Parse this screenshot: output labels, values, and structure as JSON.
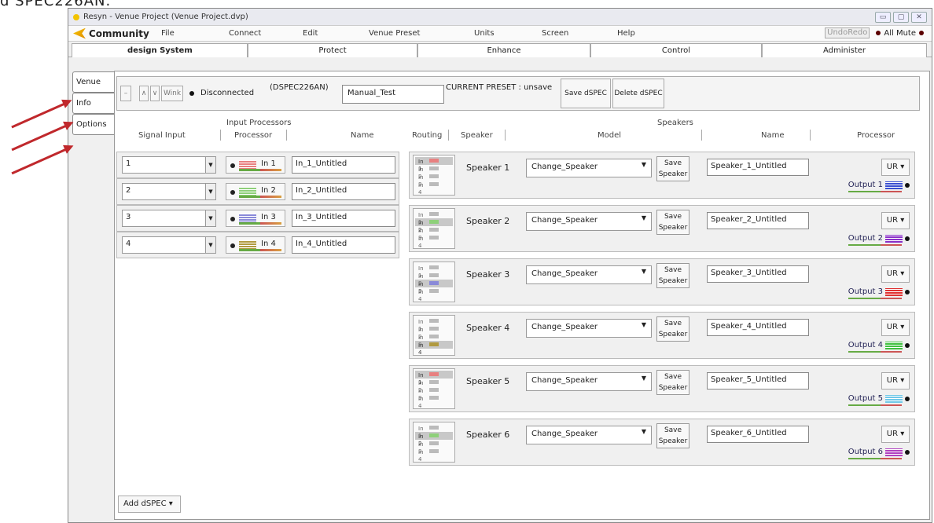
{
  "cut_text": "d SPEC226AN.",
  "window": {
    "title": "Resyn - Venue Project (Venue Project.dvp)",
    "controls": [
      "▭",
      "▢",
      "✕"
    ]
  },
  "menu": {
    "brand": "Community",
    "items": [
      "File",
      "Connect",
      "Edit",
      "Venue Preset",
      "Units",
      "Screen",
      "Help"
    ],
    "undo": "Undo",
    "redo": "Redo",
    "all_mute": "All Mute"
  },
  "tabs": [
    "design System",
    "Protect",
    "Enhance",
    "Control",
    "Administer"
  ],
  "side_tabs": [
    "Venue",
    "Info",
    "Options"
  ],
  "toolbar": {
    "collapse": "–",
    "up": "∧",
    "down": "∨",
    "wink": "Wink",
    "status": "Disconnected",
    "device": "(DSPEC226AN)",
    "device_name": "Manual_Test",
    "preset": "CURRENT PRESET : unsave",
    "save": "Save dSPEC",
    "delete": "Delete dSPEC"
  },
  "input_header": {
    "group": "Input Processors",
    "signal": "Signal Input",
    "processor": "Processor",
    "name": "Name"
  },
  "speaker_header": {
    "group": "Speakers",
    "routing": "Routing",
    "speaker": "Speaker",
    "model": "Model",
    "name": "Name",
    "processor": "Processor"
  },
  "inputs": [
    {
      "signal": "1",
      "proc": "In 1",
      "name": "In_1_Untitled",
      "color": "#e88080"
    },
    {
      "signal": "2",
      "proc": "In 2",
      "name": "In_2_Untitled",
      "color": "#8ed07a"
    },
    {
      "signal": "3",
      "proc": "In 3",
      "name": "In_3_Untitled",
      "color": "#8a8ad8"
    },
    {
      "signal": "4",
      "proc": "In 4",
      "name": "In_4_Untitled",
      "color": "#b09a40"
    }
  ],
  "routing_labels": [
    "In 1",
    "In 2",
    "In 3",
    "In 4"
  ],
  "speakers": [
    {
      "label": "Speaker 1",
      "model": "Change_Speaker",
      "save": "Save Speaker",
      "name": "Speaker_1_Untitled",
      "ur": "UR ▾",
      "output": "Output 1",
      "color": "#3a4fd0",
      "active": 0
    },
    {
      "label": "Speaker 2",
      "model": "Change_Speaker",
      "save": "Save Speaker",
      "name": "Speaker_2_Untitled",
      "ur": "UR ▾",
      "output": "Output 2",
      "color": "#8a30c8",
      "active": 1
    },
    {
      "label": "Speaker 3",
      "model": "Change_Speaker",
      "save": "Save Speaker",
      "name": "Speaker_3_Untitled",
      "ur": "UR ▾",
      "output": "Output 3",
      "color": "#e03030",
      "active": 2
    },
    {
      "label": "Speaker 4",
      "model": "Change_Speaker",
      "save": "Save Speaker",
      "name": "Speaker_4_Untitled",
      "ur": "UR ▾",
      "output": "Output 4",
      "color": "#40c040",
      "active": 3
    },
    {
      "label": "Speaker 5",
      "model": "Change_Speaker",
      "save": "Save Speaker",
      "name": "Speaker_5_Untitled",
      "ur": "UR ▾",
      "output": "Output 5",
      "color": "#70c8e8",
      "active": 0
    },
    {
      "label": "Speaker 6",
      "model": "Change_Speaker",
      "save": "Save Speaker",
      "name": "Speaker_6_Untitled",
      "ur": "UR ▾",
      "output": "Output 6",
      "color": "#b040c0",
      "active": 1
    }
  ],
  "add_dspec": "Add dSPEC ▾"
}
